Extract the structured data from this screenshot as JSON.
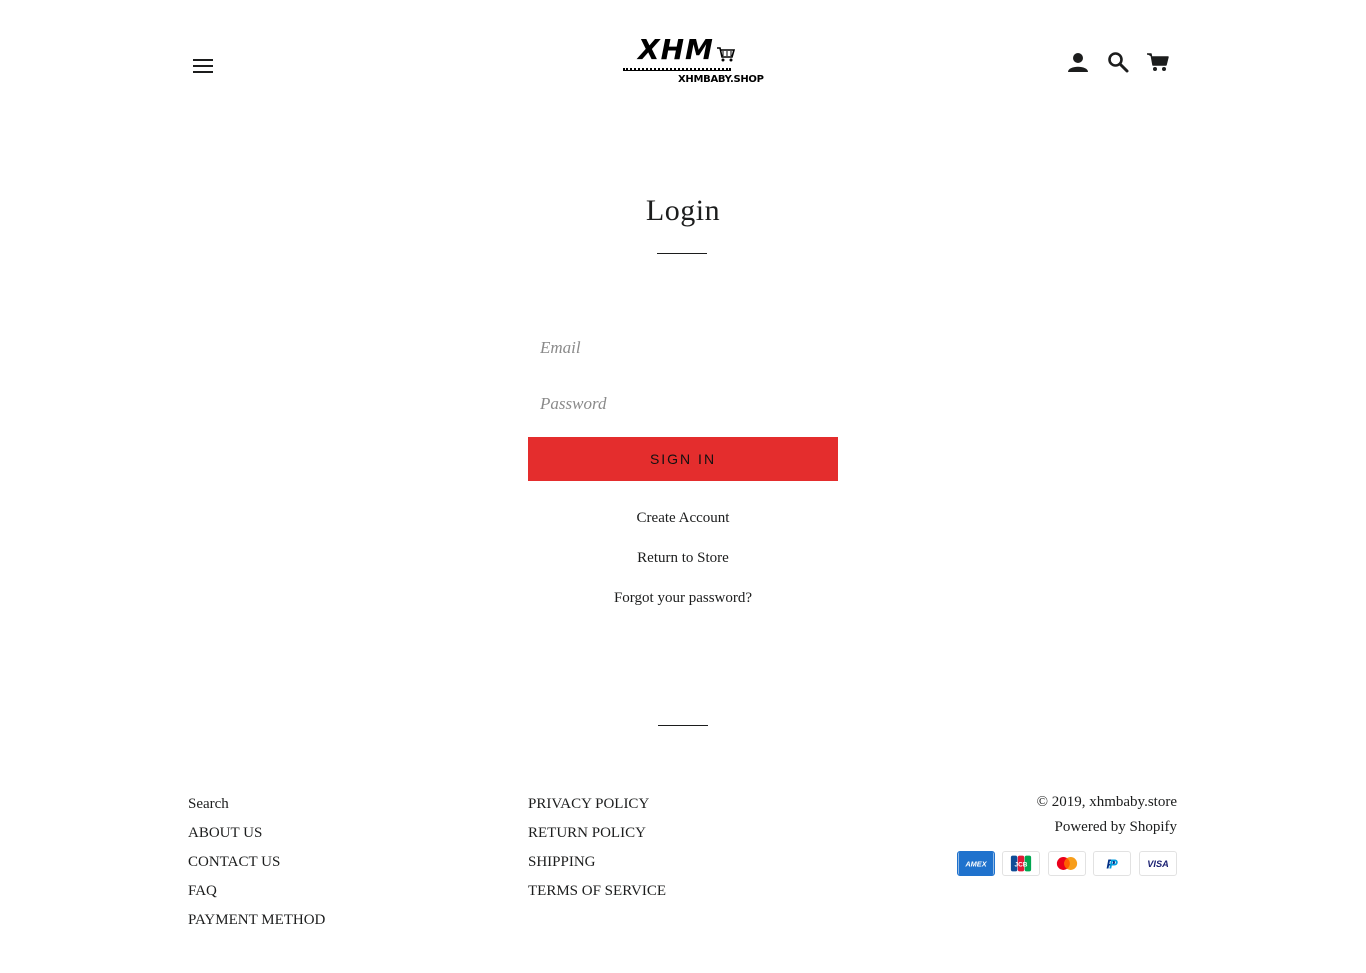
{
  "header": {
    "logo_text": "XHM",
    "logo_subtitle": "XHMBABY.SHOP"
  },
  "login": {
    "title": "Login",
    "email_placeholder": "Email",
    "password_placeholder": "Password",
    "signin_label": "SIGN IN",
    "create_account": "Create Account",
    "return_to_store": "Return to Store",
    "forgot_password": "Forgot your password?"
  },
  "footer": {
    "column1": [
      "Search",
      "ABOUT US",
      "CONTACT US",
      "FAQ",
      "PAYMENT METHOD"
    ],
    "column2": [
      "PRIVACY POLICY",
      "RETURN POLICY",
      "SHIPPING",
      "TERMS OF SERVICE"
    ],
    "copyright_prefix": "© 2019, ",
    "copyright_store": "xhmbaby.store",
    "powered_by": "Powered by Shopify",
    "payment_methods": [
      "american-express",
      "jcb",
      "mastercard",
      "paypal",
      "visa"
    ],
    "payment_labels": {
      "amex": "AMEX",
      "jcb": "JCB",
      "paypal": "P",
      "visa": "VISA"
    }
  },
  "colors": {
    "accent": "#e42d2d",
    "text": "#1c1d1d",
    "amex_blue": "#1f72cd",
    "visa_blue": "#1a1f71"
  }
}
